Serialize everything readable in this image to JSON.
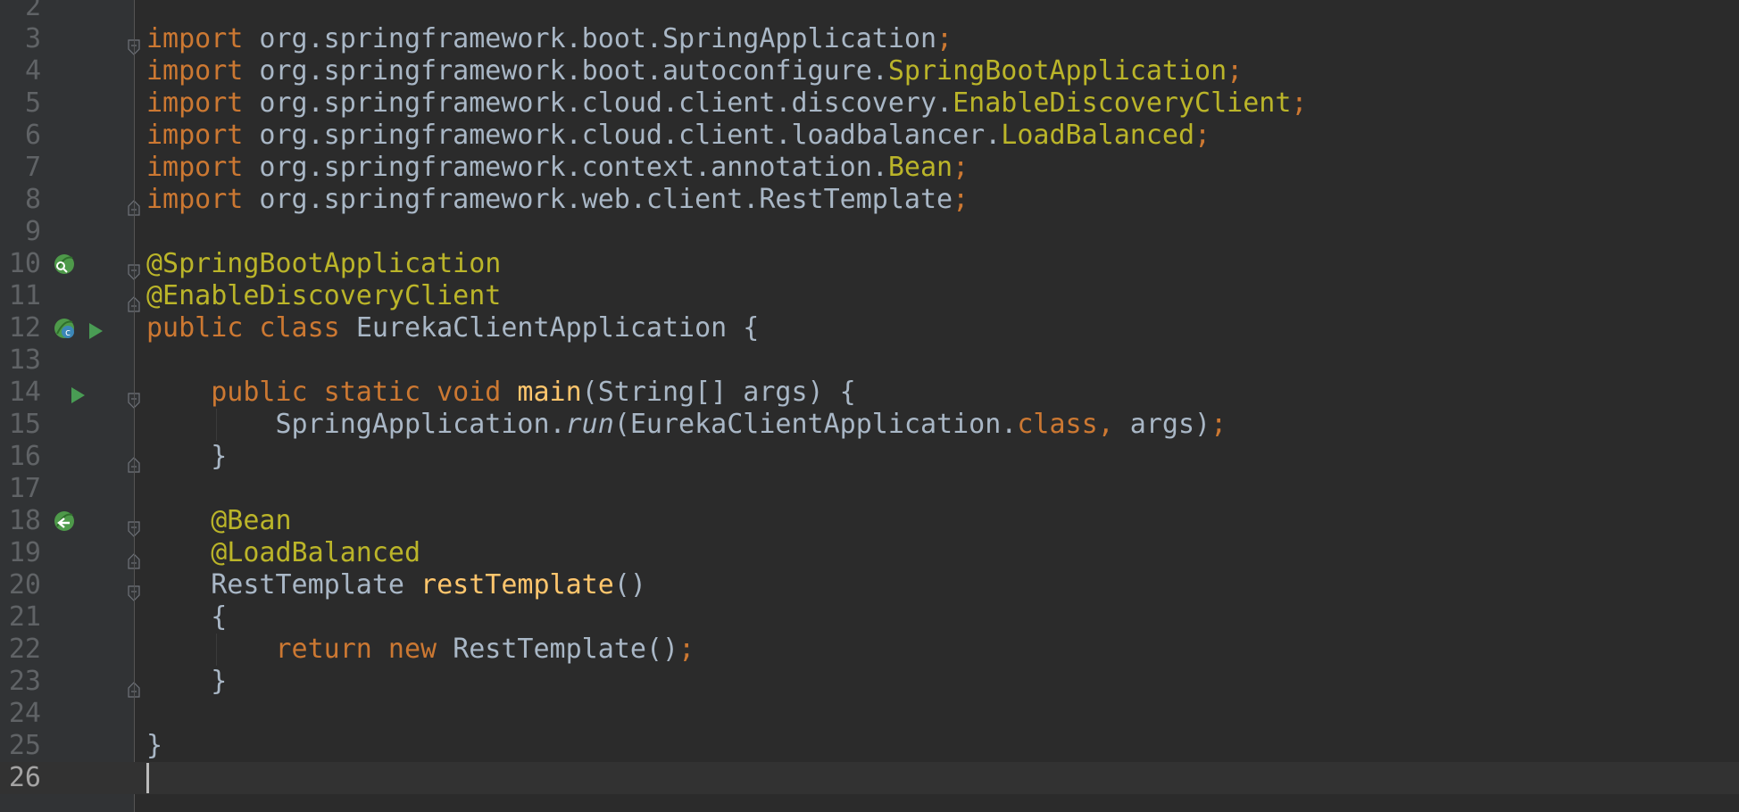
{
  "colors": {
    "background": "#2b2b2b",
    "gutter": "#313335",
    "keyword": "#cc7832",
    "annotation": "#bbb529",
    "method": "#ffc66d",
    "text": "#a9b7c6",
    "line_number": "#606366"
  },
  "editor": {
    "current_line": "26",
    "lines": [
      {
        "number": "2",
        "tokens": []
      },
      {
        "number": "3",
        "tokens": [
          {
            "text": "import",
            "kind": "kw"
          },
          {
            "text": " org.springframework.boot.SpringApplication",
            "kind": "plain"
          },
          {
            "text": ";",
            "kind": "kw"
          }
        ]
      },
      {
        "number": "4",
        "tokens": [
          {
            "text": "import",
            "kind": "kw"
          },
          {
            "text": " org.springframework.boot.autoconfigure.",
            "kind": "plain"
          },
          {
            "text": "SpringBootApplication",
            "kind": "ann"
          },
          {
            "text": ";",
            "kind": "kw"
          }
        ]
      },
      {
        "number": "5",
        "tokens": [
          {
            "text": "import",
            "kind": "kw"
          },
          {
            "text": " org.springframework.cloud.client.discovery.",
            "kind": "plain"
          },
          {
            "text": "EnableDiscoveryClient",
            "kind": "ann"
          },
          {
            "text": ";",
            "kind": "kw"
          }
        ]
      },
      {
        "number": "6",
        "tokens": [
          {
            "text": "import",
            "kind": "kw"
          },
          {
            "text": " org.springframework.cloud.client.loadbalancer.",
            "kind": "plain"
          },
          {
            "text": "LoadBalanced",
            "kind": "ann"
          },
          {
            "text": ";",
            "kind": "kw"
          }
        ]
      },
      {
        "number": "7",
        "tokens": [
          {
            "text": "import",
            "kind": "kw"
          },
          {
            "text": " org.springframework.context.annotation.",
            "kind": "plain"
          },
          {
            "text": "Bean",
            "kind": "ann"
          },
          {
            "text": ";",
            "kind": "kw"
          }
        ]
      },
      {
        "number": "8",
        "tokens": [
          {
            "text": "import",
            "kind": "kw"
          },
          {
            "text": " org.springframework.web.client.RestTemplate",
            "kind": "plain"
          },
          {
            "text": ";",
            "kind": "kw"
          }
        ]
      },
      {
        "number": "9",
        "tokens": []
      },
      {
        "number": "10",
        "tokens": [
          {
            "text": "@SpringBootApplication",
            "kind": "ann"
          }
        ]
      },
      {
        "number": "11",
        "tokens": [
          {
            "text": "@EnableDiscoveryClient",
            "kind": "ann"
          }
        ]
      },
      {
        "number": "12",
        "tokens": [
          {
            "text": "public class ",
            "kind": "kw"
          },
          {
            "text": "EurekaClientApplication {",
            "kind": "plain"
          }
        ]
      },
      {
        "number": "13",
        "tokens": []
      },
      {
        "number": "14",
        "tokens": [
          {
            "text": "    ",
            "kind": "plain"
          },
          {
            "text": "public static void ",
            "kind": "kw"
          },
          {
            "text": "main",
            "kind": "fn"
          },
          {
            "text": "(String[] args) {",
            "kind": "plain"
          }
        ]
      },
      {
        "number": "15",
        "tokens": [
          {
            "text": "        SpringApplication.",
            "kind": "plain"
          },
          {
            "text": "run",
            "kind": "it"
          },
          {
            "text": "(EurekaClientApplication.",
            "kind": "plain"
          },
          {
            "text": "class, ",
            "kind": "kw"
          },
          {
            "text": "args)",
            "kind": "plain"
          },
          {
            "text": ";",
            "kind": "kw"
          }
        ]
      },
      {
        "number": "16",
        "tokens": [
          {
            "text": "    }",
            "kind": "plain"
          }
        ]
      },
      {
        "number": "17",
        "tokens": []
      },
      {
        "number": "18",
        "tokens": [
          {
            "text": "    ",
            "kind": "plain"
          },
          {
            "text": "@Bean",
            "kind": "ann"
          }
        ]
      },
      {
        "number": "19",
        "tokens": [
          {
            "text": "    ",
            "kind": "plain"
          },
          {
            "text": "@LoadBalanced",
            "kind": "ann"
          }
        ]
      },
      {
        "number": "20",
        "tokens": [
          {
            "text": "    RestTemplate ",
            "kind": "plain"
          },
          {
            "text": "restTemplate",
            "kind": "fn"
          },
          {
            "text": "()",
            "kind": "plain"
          }
        ]
      },
      {
        "number": "21",
        "tokens": [
          {
            "text": "    {",
            "kind": "plain"
          }
        ]
      },
      {
        "number": "22",
        "tokens": [
          {
            "text": "        ",
            "kind": "plain"
          },
          {
            "text": "return new ",
            "kind": "kw"
          },
          {
            "text": "RestTemplate()",
            "kind": "plain"
          },
          {
            "text": ";",
            "kind": "kw"
          }
        ]
      },
      {
        "number": "23",
        "tokens": [
          {
            "text": "    }",
            "kind": "plain"
          }
        ]
      },
      {
        "number": "24",
        "tokens": []
      },
      {
        "number": "25",
        "tokens": [
          {
            "text": "}",
            "kind": "plain"
          }
        ]
      },
      {
        "number": "26",
        "tokens": []
      }
    ]
  },
  "gutter_icons": [
    {
      "line": "10",
      "icons": [
        "spring-bean-search-icon"
      ]
    },
    {
      "line": "12",
      "icons": [
        "spring-bean-class-icon",
        "run-icon"
      ]
    },
    {
      "line": "14",
      "icons": [
        "run-icon"
      ]
    },
    {
      "line": "18",
      "icons": [
        "spring-bean-injection-icon"
      ]
    }
  ],
  "fold_markers": [
    {
      "line": "3",
      "kind": "start"
    },
    {
      "line": "8",
      "kind": "end"
    },
    {
      "line": "10",
      "kind": "start"
    },
    {
      "line": "11",
      "kind": "end"
    },
    {
      "line": "14",
      "kind": "start"
    },
    {
      "line": "16",
      "kind": "end"
    },
    {
      "line": "18",
      "kind": "start"
    },
    {
      "line": "19",
      "kind": "end"
    },
    {
      "line": "20",
      "kind": "start"
    },
    {
      "line": "23",
      "kind": "end"
    }
  ]
}
